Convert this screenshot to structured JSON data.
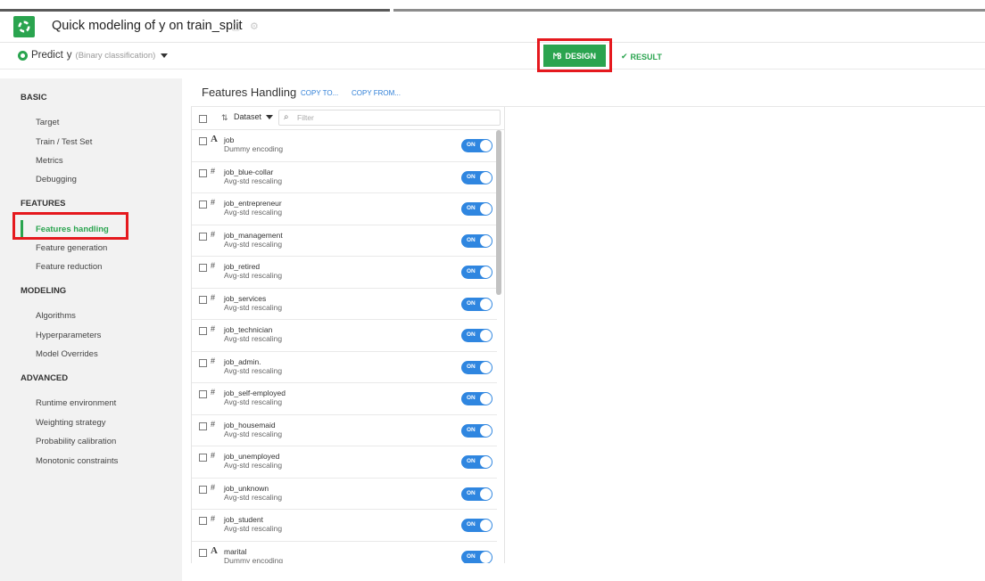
{
  "header": {
    "title": "Quick modeling of y on train_split",
    "logo_icon": "dataiku-bird-icon",
    "icons": [
      "copy-icon",
      "settings-icon"
    ]
  },
  "subheader": {
    "predict_label": "Predict",
    "predict_target": "y",
    "predict_type": "(Binary classification)",
    "design_label": "DESIGN",
    "result_label": "RESULT",
    "accent_color": "#2aa44f",
    "highlight_color": "#e5191e"
  },
  "sidebar": {
    "sections": [
      {
        "title": "BASIC",
        "items": [
          "Target",
          "Train / Test Set",
          "Metrics",
          "Debugging"
        ]
      },
      {
        "title": "FEATURES",
        "items": [
          "Features handling",
          "Feature generation",
          "Feature reduction"
        ]
      },
      {
        "title": "MODELING",
        "items": [
          "Algorithms",
          "Hyperparameters",
          "Model Overrides"
        ]
      },
      {
        "title": "ADVANCED",
        "items": [
          "Runtime environment",
          "Weighting strategy",
          "Probability calibration",
          "Monotonic constraints"
        ]
      }
    ],
    "active_item": "Features handling"
  },
  "panel": {
    "title": "Features Handling",
    "copy_to": "COPY TO...",
    "copy_from": "COPY FROM...",
    "dataset_select": "Dataset",
    "filter_placeholder": "Filter"
  },
  "features": [
    {
      "type": "A",
      "name": "job",
      "handling": "Dummy encoding",
      "state": "ON"
    },
    {
      "type": "#",
      "name": "job_blue-collar",
      "handling": "Avg-std rescaling",
      "state": "ON"
    },
    {
      "type": "#",
      "name": "job_entrepreneur",
      "handling": "Avg-std rescaling",
      "state": "ON"
    },
    {
      "type": "#",
      "name": "job_management",
      "handling": "Avg-std rescaling",
      "state": "ON"
    },
    {
      "type": "#",
      "name": "job_retired",
      "handling": "Avg-std rescaling",
      "state": "ON"
    },
    {
      "type": "#",
      "name": "job_services",
      "handling": "Avg-std rescaling",
      "state": "ON"
    },
    {
      "type": "#",
      "name": "job_technician",
      "handling": "Avg-std rescaling",
      "state": "ON"
    },
    {
      "type": "#",
      "name": "job_admin.",
      "handling": "Avg-std rescaling",
      "state": "ON"
    },
    {
      "type": "#",
      "name": "job_self-employed",
      "handling": "Avg-std rescaling",
      "state": "ON"
    },
    {
      "type": "#",
      "name": "job_housemaid",
      "handling": "Avg-std rescaling",
      "state": "ON"
    },
    {
      "type": "#",
      "name": "job_unemployed",
      "handling": "Avg-std rescaling",
      "state": "ON"
    },
    {
      "type": "#",
      "name": "job_unknown",
      "handling": "Avg-std rescaling",
      "state": "ON"
    },
    {
      "type": "#",
      "name": "job_student",
      "handling": "Avg-std rescaling",
      "state": "ON"
    },
    {
      "type": "A",
      "name": "marital",
      "handling": "Dummy encoding",
      "state": "ON"
    }
  ]
}
